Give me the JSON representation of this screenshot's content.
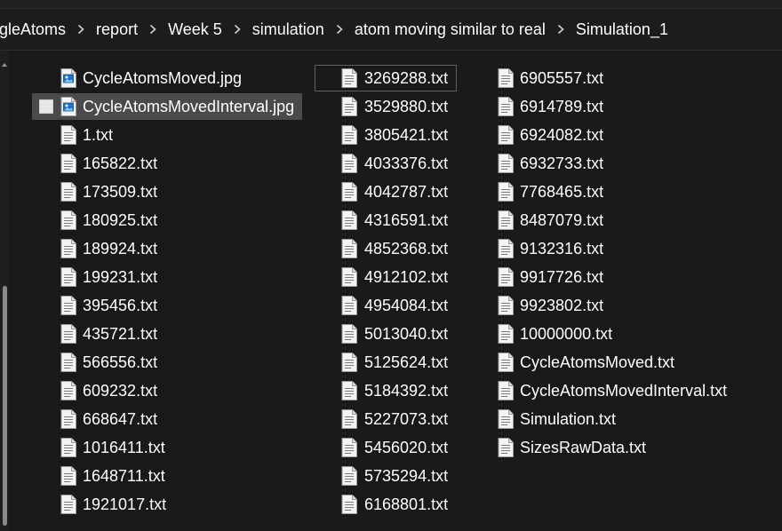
{
  "breadcrumb": {
    "items": [
      "gleAtoms",
      "report",
      "Week 5",
      "simulation",
      "atom moving similar to real",
      "Simulation_1"
    ]
  },
  "icons": {
    "separator": "chevron-right-icon",
    "text_file": "text-document-icon",
    "image_file": "image-file-icon"
  },
  "colors": {
    "background": "#191919",
    "selection": "#4a4a4a",
    "text": "#ffffff"
  },
  "files": {
    "column1": [
      {
        "name": "CycleAtomsMoved.jpg",
        "type": "image"
      },
      {
        "name": "CycleAtomsMovedInterval.jpg",
        "type": "image",
        "selected": true,
        "checked": false
      },
      {
        "name": "1.txt",
        "type": "text"
      },
      {
        "name": "165822.txt",
        "type": "text"
      },
      {
        "name": "173509.txt",
        "type": "text"
      },
      {
        "name": "180925.txt",
        "type": "text"
      },
      {
        "name": "189924.txt",
        "type": "text"
      },
      {
        "name": "199231.txt",
        "type": "text"
      },
      {
        "name": "395456.txt",
        "type": "text"
      },
      {
        "name": "435721.txt",
        "type": "text"
      },
      {
        "name": "566556.txt",
        "type": "text"
      },
      {
        "name": "609232.txt",
        "type": "text"
      },
      {
        "name": "668647.txt",
        "type": "text"
      },
      {
        "name": "1016411.txt",
        "type": "text"
      },
      {
        "name": "1648711.txt",
        "type": "text"
      },
      {
        "name": "1921017.txt",
        "type": "text"
      }
    ],
    "column2": [
      {
        "name": "3269288.txt",
        "type": "text",
        "focused": true
      },
      {
        "name": "3529880.txt",
        "type": "text"
      },
      {
        "name": "3805421.txt",
        "type": "text"
      },
      {
        "name": "4033376.txt",
        "type": "text"
      },
      {
        "name": "4042787.txt",
        "type": "text"
      },
      {
        "name": "4316591.txt",
        "type": "text"
      },
      {
        "name": "4852368.txt",
        "type": "text"
      },
      {
        "name": "4912102.txt",
        "type": "text"
      },
      {
        "name": "4954084.txt",
        "type": "text"
      },
      {
        "name": "5013040.txt",
        "type": "text"
      },
      {
        "name": "5125624.txt",
        "type": "text"
      },
      {
        "name": "5184392.txt",
        "type": "text"
      },
      {
        "name": "5227073.txt",
        "type": "text"
      },
      {
        "name": "5456020.txt",
        "type": "text"
      },
      {
        "name": "5735294.txt",
        "type": "text"
      },
      {
        "name": "6168801.txt",
        "type": "text"
      }
    ],
    "column3": [
      {
        "name": "6905557.txt",
        "type": "text"
      },
      {
        "name": "6914789.txt",
        "type": "text"
      },
      {
        "name": "6924082.txt",
        "type": "text"
      },
      {
        "name": "6932733.txt",
        "type": "text"
      },
      {
        "name": "7768465.txt",
        "type": "text"
      },
      {
        "name": "8487079.txt",
        "type": "text"
      },
      {
        "name": "9132316.txt",
        "type": "text"
      },
      {
        "name": "9917726.txt",
        "type": "text"
      },
      {
        "name": "9923802.txt",
        "type": "text"
      },
      {
        "name": "10000000.txt",
        "type": "text"
      },
      {
        "name": "CycleAtomsMoved.txt",
        "type": "text"
      },
      {
        "name": "CycleAtomsMovedInterval.txt",
        "type": "text"
      },
      {
        "name": "Simulation.txt",
        "type": "text"
      },
      {
        "name": "SizesRawData.txt",
        "type": "text"
      }
    ]
  }
}
